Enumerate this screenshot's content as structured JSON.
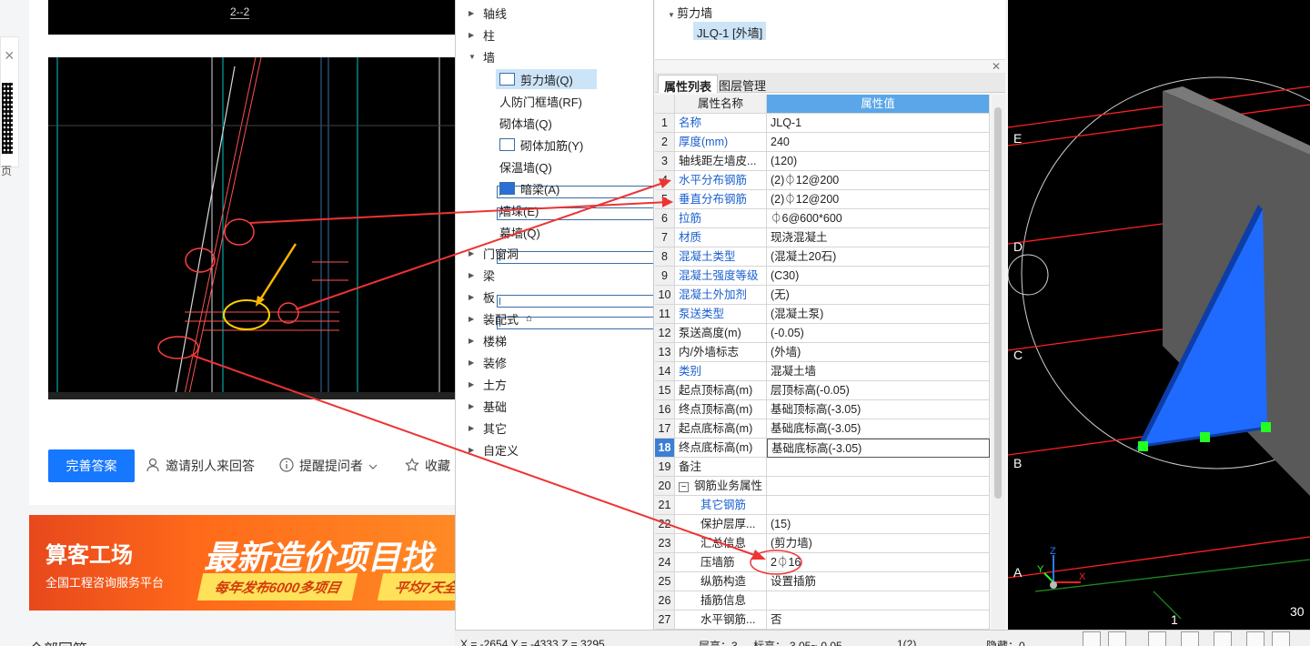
{
  "side": {
    "close": "×",
    "label": "页"
  },
  "cad": {
    "top_label": "2--2"
  },
  "actions": {
    "answer_button": "完善答案",
    "invite": "邀请别人来回答",
    "remind": "提醒提问者",
    "collect": "收藏"
  },
  "ad": {
    "logo": "算客工场",
    "sub": "全国工程咨询服务平台",
    "headline": "最新造价项目找",
    "pill1": "每年发布6000多项目",
    "pill2": "平均7天全"
  },
  "bottom_text": "全部回答",
  "tree": {
    "top_items": [
      "轴线",
      "柱",
      "墙"
    ],
    "wall_children": [
      "剪力墙(Q)",
      "人防门框墙(RF)",
      "砌体墙(Q)",
      "砌体加筋(Y)",
      "保温墙(Q)",
      "暗梁(A)",
      "墙垛(E)",
      "幕墙(Q)"
    ],
    "other_items": [
      "门窗洞",
      "梁",
      "板",
      "装配式",
      "楼梯",
      "装修",
      "土方",
      "基础",
      "其它",
      "自定义"
    ]
  },
  "props_top": {
    "node": "剪力墙",
    "selected": "JLQ-1 [外墙]"
  },
  "tabs": {
    "t1": "属性列表",
    "t2": "图层管理"
  },
  "grid": {
    "header": {
      "name": "属性名称",
      "value": "属性值"
    },
    "rows": [
      {
        "n": "1",
        "name": "名称",
        "value": "JLQ-1",
        "blue": true
      },
      {
        "n": "2",
        "name": "厚度(mm)",
        "value": "240",
        "blue": true
      },
      {
        "n": "3",
        "name": "轴线距左墙皮...",
        "value": "(120)",
        "blue": false
      },
      {
        "n": "4",
        "name": "水平分布钢筋",
        "value": "(2)⏀12@200",
        "blue": true
      },
      {
        "n": "5",
        "name": "垂直分布钢筋",
        "value": "(2)⏀12@200",
        "blue": true
      },
      {
        "n": "6",
        "name": "拉筋",
        "value": "⏀6@600*600",
        "blue": true
      },
      {
        "n": "7",
        "name": "材质",
        "value": "现浇混凝土",
        "blue": true
      },
      {
        "n": "8",
        "name": "混凝土类型",
        "value": "(混凝土20石)",
        "blue": true
      },
      {
        "n": "9",
        "name": "混凝土强度等级",
        "value": "(C30)",
        "blue": true
      },
      {
        "n": "10",
        "name": "混凝土外加剂",
        "value": "(无)",
        "blue": true
      },
      {
        "n": "11",
        "name": "泵送类型",
        "value": "(混凝土泵)",
        "blue": true
      },
      {
        "n": "12",
        "name": "泵送高度(m)",
        "value": "(-0.05)",
        "blue": false
      },
      {
        "n": "13",
        "name": "内/外墙标志",
        "value": "(外墙)",
        "blue": false
      },
      {
        "n": "14",
        "name": "类别",
        "value": "混凝土墙",
        "blue": true
      },
      {
        "n": "15",
        "name": "起点顶标高(m)",
        "value": "层顶标高(-0.05)",
        "blue": false
      },
      {
        "n": "16",
        "name": "终点顶标高(m)",
        "value": "基础顶标高(-3.05)",
        "blue": false
      },
      {
        "n": "17",
        "name": "起点底标高(m)",
        "value": "基础底标高(-3.05)",
        "blue": false
      },
      {
        "n": "18",
        "name": "终点底标高(m)",
        "value": "基础底标高(-3.05)",
        "blue": false
      },
      {
        "n": "19",
        "name": "备注",
        "value": "",
        "blue": false
      },
      {
        "n": "20",
        "name": "钢筋业务属性",
        "value": "",
        "blue": false
      },
      {
        "n": "21",
        "name": "其它钢筋",
        "value": "",
        "blue": true
      },
      {
        "n": "22",
        "name": "保护层厚...",
        "value": "(15)",
        "blue": false
      },
      {
        "n": "23",
        "name": "汇总信息",
        "value": "(剪力墙)",
        "blue": false
      },
      {
        "n": "24",
        "name": "压墙筋",
        "value": "2⏀16",
        "blue": false
      },
      {
        "n": "25",
        "name": "纵筋构造",
        "value": "设置插筋",
        "blue": false
      },
      {
        "n": "26",
        "name": "插筋信息",
        "value": "",
        "blue": false
      },
      {
        "n": "27",
        "name": "水平钢筋...",
        "value": "否",
        "blue": false
      }
    ]
  },
  "axes": [
    "E",
    "D",
    "C",
    "B",
    "A",
    "1"
  ],
  "view_num": "30",
  "status": {
    "coords": "X = -2654 Y = -4333 Z = 3295",
    "floor": "层高：3",
    "elev": "标高：-3.05~-0.05",
    "count": "1(2)",
    "hidden": "隐藏：0"
  },
  "colors": {
    "accent": "#1677ff",
    "wall_blue": "#1f6bff",
    "cad_red": "#ff2a2a"
  }
}
